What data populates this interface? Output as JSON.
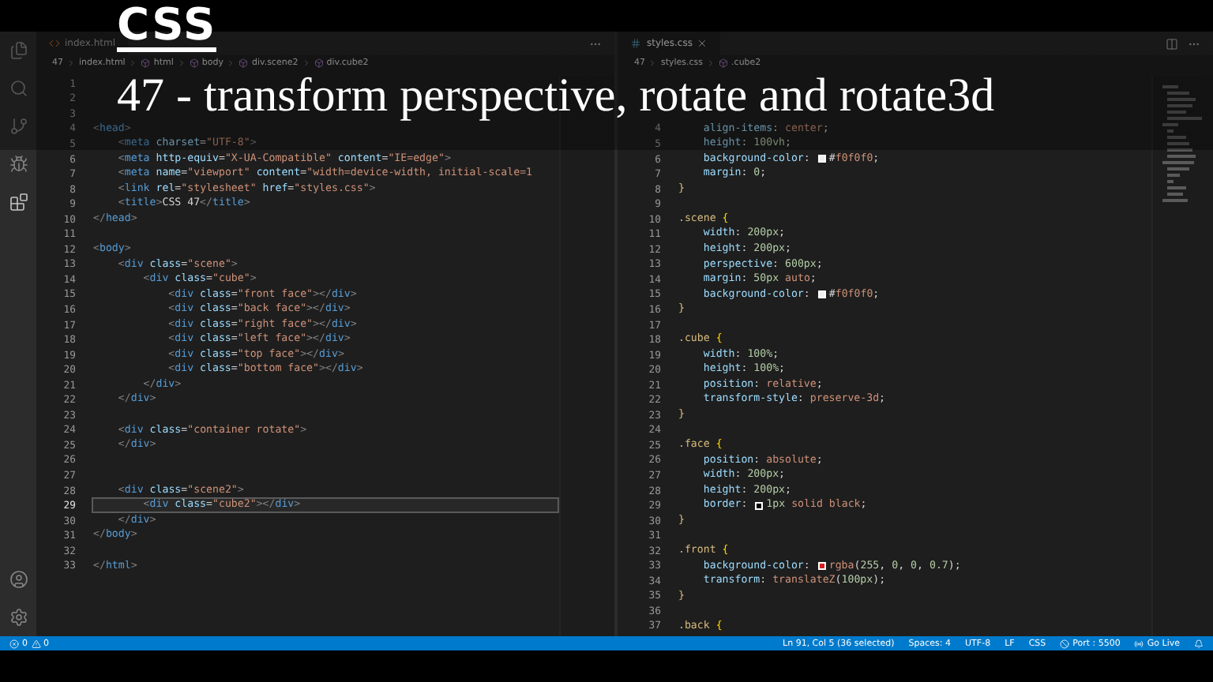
{
  "overlay": {
    "badge": "CSS",
    "title": "47 - transform perspective, rotate and rotate3d"
  },
  "editors": [
    {
      "kind": "html",
      "tab": {
        "label": "index.html",
        "closable": false
      },
      "breadcrumb": [
        "47",
        "index.html",
        "html",
        "body",
        "div.scene2",
        "div.cube2"
      ],
      "lines": [
        {
          "n": "1",
          "current": false
        },
        {
          "n": "2",
          "current": false
        },
        {
          "n": "3",
          "current": false
        },
        {
          "n": "4",
          "code": "<head>",
          "current": false
        },
        {
          "n": "5",
          "code": "    <meta charset=\"UTF-8\">",
          "current": false
        },
        {
          "n": "6",
          "code": "    <meta http-equiv=\"X-UA-Compatible\" content=\"IE=edge\">",
          "current": false
        },
        {
          "n": "7",
          "code": "    <meta name=\"viewport\" content=\"width=device-width, initial-scale=1",
          "current": false
        },
        {
          "n": "8",
          "code": "    <link rel=\"stylesheet\" href=\"styles.css\">",
          "current": false
        },
        {
          "n": "9",
          "code": "    <title>CSS 47</title>",
          "current": false
        },
        {
          "n": "10",
          "code": "</head>",
          "current": false
        },
        {
          "n": "11",
          "current": false
        },
        {
          "n": "12",
          "code": "<body>",
          "current": false
        },
        {
          "n": "13",
          "code": "    <div class=\"scene\">",
          "current": false
        },
        {
          "n": "14",
          "code": "        <div class=\"cube\">",
          "current": false
        },
        {
          "n": "15",
          "code": "            <div class=\"front face\"></div>",
          "current": false
        },
        {
          "n": "16",
          "code": "            <div class=\"back face\"></div>",
          "current": false
        },
        {
          "n": "17",
          "code": "            <div class=\"right face\"></div>",
          "current": false
        },
        {
          "n": "18",
          "code": "            <div class=\"left face\"></div>",
          "current": false
        },
        {
          "n": "19",
          "code": "            <div class=\"top face\"></div>",
          "current": false
        },
        {
          "n": "20",
          "code": "            <div class=\"bottom face\"></div>",
          "current": false
        },
        {
          "n": "21",
          "code": "        </div>",
          "current": false
        },
        {
          "n": "22",
          "code": "    </div>",
          "current": false
        },
        {
          "n": "23",
          "current": false
        },
        {
          "n": "24",
          "code": "    <div class=\"container rotate\">",
          "current": false
        },
        {
          "n": "25",
          "code": "    </div>",
          "current": false
        },
        {
          "n": "26",
          "current": false
        },
        {
          "n": "27",
          "current": false
        },
        {
          "n": "28",
          "code": "    <div class=\"scene2\">",
          "current": false
        },
        {
          "n": "29",
          "code": "        <div class=\"cube2\"></div>",
          "current": true
        },
        {
          "n": "30",
          "code": "    </div>",
          "current": false
        },
        {
          "n": "31",
          "code": "</body>",
          "current": false
        },
        {
          "n": "32",
          "current": false
        },
        {
          "n": "33",
          "code": "</html>",
          "current": false
        }
      ]
    },
    {
      "kind": "css",
      "tab": {
        "label": "styles.css",
        "closable": true
      },
      "breadcrumb": [
        "47",
        "styles.css",
        ".cube2"
      ],
      "lines": [
        {
          "current": false
        },
        {
          "current": false
        },
        {
          "current": false
        },
        {
          "n": "4",
          "code": "    align-items: center;",
          "current": false
        },
        {
          "n": "5",
          "code": "    height: 100vh;",
          "current": false
        },
        {
          "n": "6",
          "code": "    background-color: #f0f0f0;",
          "color": "#f0f0f0",
          "current": false
        },
        {
          "n": "7",
          "code": "    margin: 0;",
          "current": false
        },
        {
          "n": "8",
          "code": "}",
          "current": false
        },
        {
          "n": "9",
          "current": false
        },
        {
          "n": "10",
          "code": ".scene {",
          "current": false
        },
        {
          "n": "11",
          "code": "    width: 200px;",
          "current": false
        },
        {
          "n": "12",
          "code": "    height: 200px;",
          "current": false
        },
        {
          "n": "13",
          "code": "    perspective: 600px;",
          "current": false
        },
        {
          "n": "14",
          "code": "    margin: 50px auto;",
          "current": false
        },
        {
          "n": "15",
          "code": "    background-color: #f0f0f0;",
          "color": "#f0f0f0",
          "current": false
        },
        {
          "n": "16",
          "code": "}",
          "current": false
        },
        {
          "n": "17",
          "current": false
        },
        {
          "n": "18",
          "code": ".cube {",
          "current": false
        },
        {
          "n": "19",
          "code": "    width: 100%;",
          "current": false
        },
        {
          "n": "20",
          "code": "    height: 100%;",
          "current": false
        },
        {
          "n": "21",
          "code": "    position: relative;",
          "current": false
        },
        {
          "n": "22",
          "code": "    transform-style: preserve-3d;",
          "current": false
        },
        {
          "n": "23",
          "code": "}",
          "current": false
        },
        {
          "n": "24",
          "current": false
        },
        {
          "n": "25",
          "code": ".face {",
          "current": false
        },
        {
          "n": "26",
          "code": "    position: absolute;",
          "current": false
        },
        {
          "n": "27",
          "code": "    width: 200px;",
          "current": false
        },
        {
          "n": "28",
          "code": "    height: 200px;",
          "current": false
        },
        {
          "n": "29",
          "code": "    border: 1px solid black;",
          "color": "#000000",
          "current": false
        },
        {
          "n": "30",
          "code": "}",
          "current": false
        },
        {
          "n": "31",
          "current": false
        },
        {
          "n": "32",
          "code": ".front {",
          "current": false
        },
        {
          "n": "33",
          "code": "    background-color: rgba(255, 0, 0, 0.7);",
          "color": "#d42020",
          "current": false
        },
        {
          "n": "34",
          "code": "    transform: translateZ(100px);",
          "current": false
        },
        {
          "n": "35",
          "code": "}",
          "current": false
        },
        {
          "n": "36",
          "current": false
        },
        {
          "n": "37",
          "code": ".back {",
          "current": false
        }
      ]
    }
  ],
  "status_bar": {
    "errors": "0",
    "warnings": "0",
    "items": [
      "Ln 91, Col 5 (36 selected)",
      "Spaces: 4",
      "UTF-8",
      "LF",
      "CSS"
    ],
    "port": "Port : 5500",
    "go_live": "Go Live"
  }
}
